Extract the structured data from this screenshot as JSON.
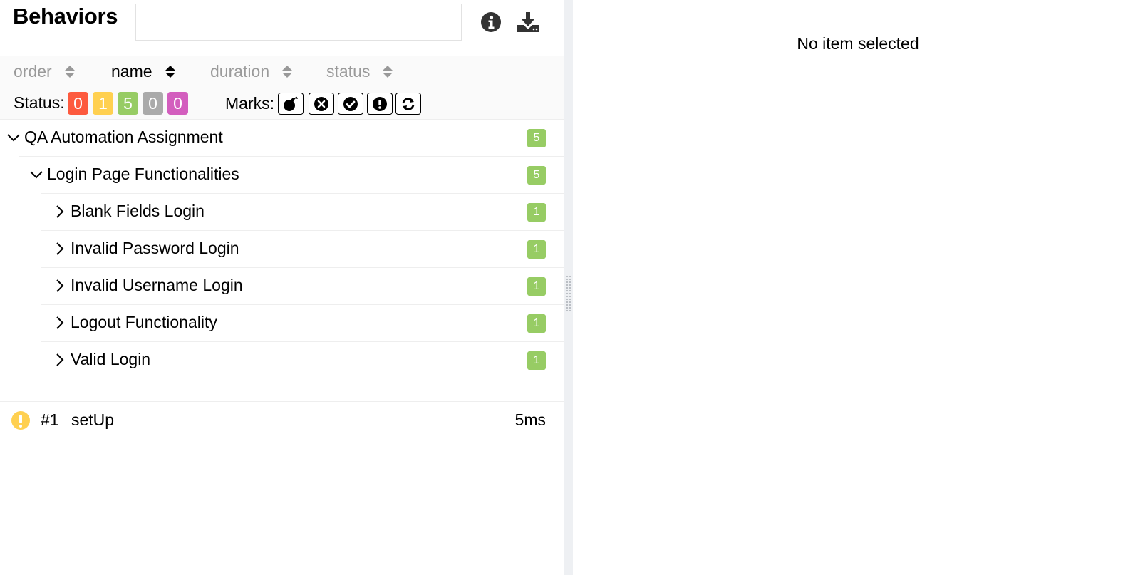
{
  "header": {
    "title": "Behaviors",
    "search_value": "",
    "search_placeholder": ""
  },
  "sorters": [
    {
      "label": "order",
      "active": false
    },
    {
      "label": "name",
      "active": true
    },
    {
      "label": "duration",
      "active": false
    },
    {
      "label": "status",
      "active": false
    }
  ],
  "status_filter": {
    "label": "Status:",
    "badges": [
      {
        "status": "failed",
        "count": "0",
        "color": "#fd5a3e"
      },
      {
        "status": "broken",
        "count": "1",
        "color": "#ffd050"
      },
      {
        "status": "passed",
        "count": "5",
        "color": "#97cc64"
      },
      {
        "status": "skipped",
        "count": "0",
        "color": "#aaaaaa"
      },
      {
        "status": "unknown",
        "count": "0",
        "color": "#d35ebe"
      }
    ]
  },
  "marks": {
    "label": "Marks:",
    "buttons": [
      "flaky-bomb-icon",
      "new-failed-icon",
      "new-passed-icon",
      "new-broken-icon",
      "retries-icon"
    ]
  },
  "tree": {
    "root": {
      "label": "QA Automation Assignment",
      "count": "5"
    },
    "group": {
      "label": "Login Page Functionalities",
      "count": "5"
    },
    "leaves": [
      {
        "label": "Blank Fields Login",
        "count": "1"
      },
      {
        "label": "Invalid Password Login",
        "count": "1"
      },
      {
        "label": "Invalid Username Login",
        "count": "1"
      },
      {
        "label": "Logout Functionality",
        "count": "1"
      },
      {
        "label": "Valid Login",
        "count": "1"
      }
    ]
  },
  "step": {
    "number": "#1",
    "name": "setUp",
    "duration": "5ms",
    "status": "broken"
  },
  "detail": {
    "empty_message": "No item selected"
  },
  "colors": {
    "passed": "#97cc64",
    "broken": "#ffd050",
    "failed": "#fd5a3e",
    "skipped": "#aaaaaa",
    "unknown": "#d35ebe"
  }
}
